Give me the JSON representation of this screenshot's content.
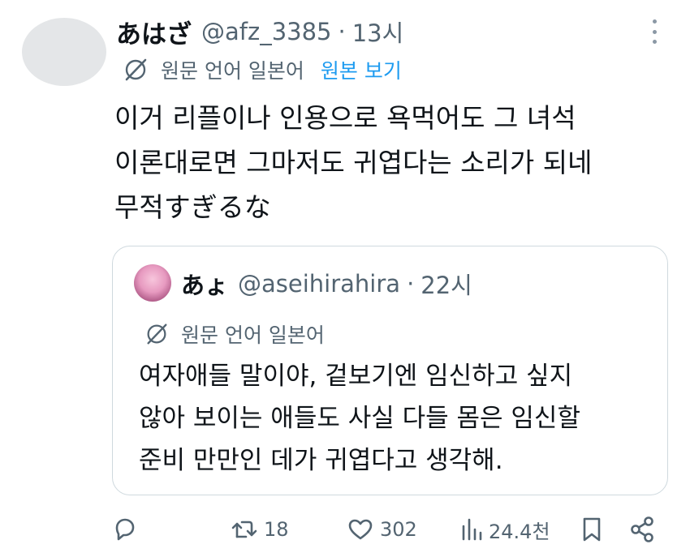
{
  "tweet": {
    "author_name": "あはざ",
    "author_handle": "@afz_3385",
    "separator": "·",
    "time": "13시",
    "translation": {
      "language_label": "원문 언어 일본어",
      "show_original": "원본 보기"
    },
    "body_lines": [
      "이거 리플이나 인용으로 욕먹어도 그 녀석",
      "이론대로면 그마저도 귀엽다는 소리가 되네",
      "무적すぎるな"
    ]
  },
  "quoted_tweet": {
    "author_name": "あょ",
    "author_handle": "@aseihirahira",
    "separator": "·",
    "time": "22시",
    "translation": {
      "language_label": "원문 언어 일본어"
    },
    "body_lines": [
      "여자애들 말이야, 겉보기엔 임신하고 싶지",
      "않아 보이는 애들도 사실 다들 몸은 임신할",
      "준비 만만인 데가 귀엽다고 생각해."
    ]
  },
  "actions": {
    "reply": {
      "icon": "reply-icon"
    },
    "retweet": {
      "icon": "retweet-icon",
      "count": "18"
    },
    "like": {
      "icon": "heart-icon",
      "count": "302"
    },
    "views": {
      "icon": "views-icon",
      "count": "24.4천"
    },
    "bookmark": {
      "icon": "bookmark-icon"
    },
    "share": {
      "icon": "share-icon"
    }
  },
  "colors": {
    "text": "#0f1419",
    "secondary": "#536471",
    "link": "#1d9bf0",
    "border": "#cfd9de"
  }
}
